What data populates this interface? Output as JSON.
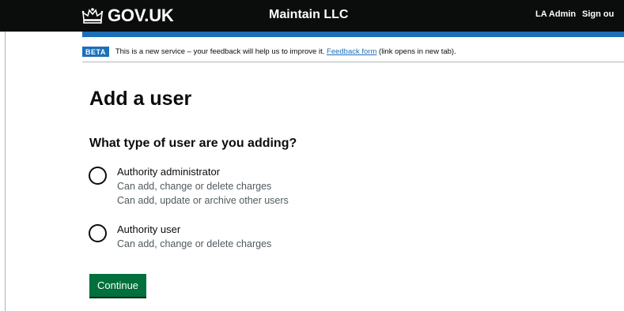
{
  "header": {
    "logo_text": "GOV.UK",
    "logo_icon": "crown-icon",
    "service_name": "Maintain LLC",
    "nav": {
      "user_label": "LA Admin",
      "sign_out_label": "Sign ou"
    },
    "colors": {
      "background": "#0b0c0c",
      "stripe": "#1d70b8"
    }
  },
  "phase_banner": {
    "tag": "BETA",
    "text_before": "This is a new service – your feedback will help us to improve it. ",
    "link_text": "Feedback form",
    "text_after": " (link opens in new tab)."
  },
  "main": {
    "title": "Add a user",
    "question": "What type of user are you adding?",
    "options": [
      {
        "label": "Authority administrator",
        "hints": [
          "Can add, change or delete charges",
          "Can add, update or archive other users"
        ],
        "selected": false
      },
      {
        "label": "Authority user",
        "hints": [
          "Can add, change or delete charges"
        ],
        "selected": false
      }
    ],
    "continue_label": "Continue",
    "colors": {
      "button": "#00703c",
      "link": "#1d70b8"
    }
  }
}
